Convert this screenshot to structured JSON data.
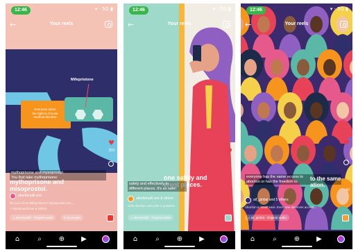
{
  "status": {
    "time": "12:46",
    "system_icons": "▾ · 5G ▮"
  },
  "phones": [
    {
      "title": "Your reels",
      "caption_small": "mythoprisone and mysoprostyl.\nYou first take mythoprisone",
      "caption_big": "mythoprisone and\nmisoprostol.",
      "pill_label": "Mifepristone",
      "card_text": "Everyone takes\nthe right to choose\nmedical abortion",
      "likes": "203",
      "account": "abortionpill.one",
      "description": "Did you know Mifepristone? Mysoprostol are...",
      "link_text": "↗ abortionpill.one & others",
      "audio": "♫ abortionpill · Original audio",
      "audio2": "♥ 12 people"
    },
    {
      "title": "Your reels",
      "caption_small": "safely and effectively in\ndifferent places. It's so safe!",
      "caption_big": "safely and\ndifferent places.",
      "caption_overlay": "one safely and\nerent places.",
      "account": "abortionpill.one & others",
      "description": "Safe abortion with pills is possible...",
      "audio": "♫ abortionpill · Original audio"
    },
    {
      "title": "Your reels",
      "caption_small": "everyone has the same access to\nabortion or has the freedom to",
      "caption_big": "to the same\nation.",
      "account": "aif_global and 5 others",
      "description": "Abortion is healthcare. Everyone deserves access...",
      "likes": "43",
      "audio": "♫ aif_global · Original audio"
    }
  ],
  "nav": {
    "home": "⌂",
    "search": "⌕",
    "add": "⊕",
    "reels": "▶",
    "profile": ""
  },
  "colors": {
    "accent": "#39b54a",
    "heart": "#e53b4b",
    "panel1_top": "#f5c4b4",
    "panel1_mid": "#2e2f6b",
    "panel2_teal": "#9fd9c9",
    "panel2_dark": "#1d2a4a"
  }
}
